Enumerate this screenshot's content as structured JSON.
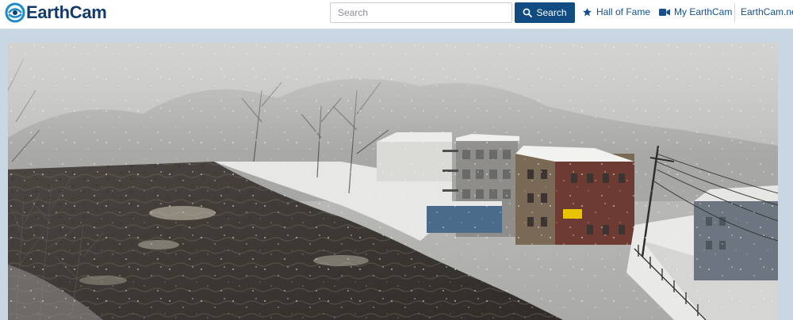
{
  "header": {
    "logo_text": "EarthCam",
    "search": {
      "placeholder": "Search",
      "value": "",
      "button_label": "Search"
    },
    "nav": {
      "hall_of_fame": "Hall of Fame",
      "my_earthcam": "My EarthCam",
      "earthcam_net": "EarthCam.net"
    }
  },
  "camera": {
    "scene": "snowy river webcam view",
    "sign_color": "#e8c400"
  },
  "icons": {
    "logo": "earthcam-globe-icon",
    "search": "search-icon",
    "star": "star-icon",
    "camera": "video-camera-icon"
  },
  "colors": {
    "brand": "#123b6b",
    "button": "#104b82",
    "link": "#14508e"
  }
}
